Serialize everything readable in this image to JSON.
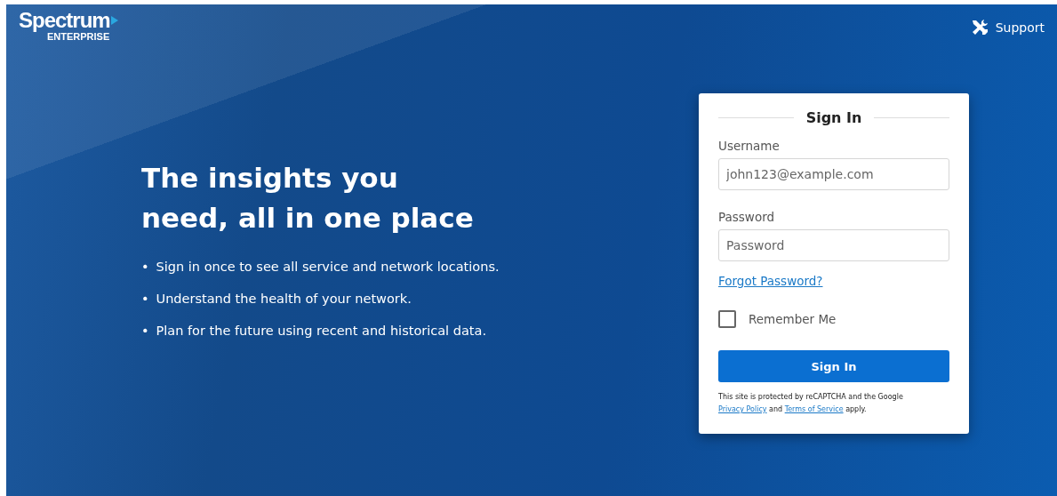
{
  "header": {
    "logo": {
      "name": "Spectrum",
      "sub": "ENTERPRISE"
    },
    "support_link": "Support"
  },
  "hero": {
    "headline_lines": [
      "The insights you",
      "need, all in one place"
    ],
    "bullets": [
      {
        "marker": "•",
        "text": "Sign in once to see all service and network locations."
      },
      {
        "marker": "•",
        "text": "Understand the health of your network."
      },
      {
        "marker": "•",
        "text": "Plan for the future using recent and historical data."
      }
    ]
  },
  "sign_in_card": {
    "title": "Sign In",
    "username": {
      "label": "Username",
      "placeholder": "john123@example.com"
    },
    "password": {
      "label": "Password",
      "placeholder": "Password"
    },
    "forgot_link": "Forgot Password?",
    "remember_me": {
      "label": "Remember Me",
      "checked": false
    },
    "submit_button": "Sign In",
    "recaptcha_note": {
      "before": "This site is protected by reCAPTCHA and the Google",
      "privacy_link": "Privacy Policy",
      "middle": "and",
      "terms_link": "Terms of Service",
      "after": "apply."
    }
  }
}
